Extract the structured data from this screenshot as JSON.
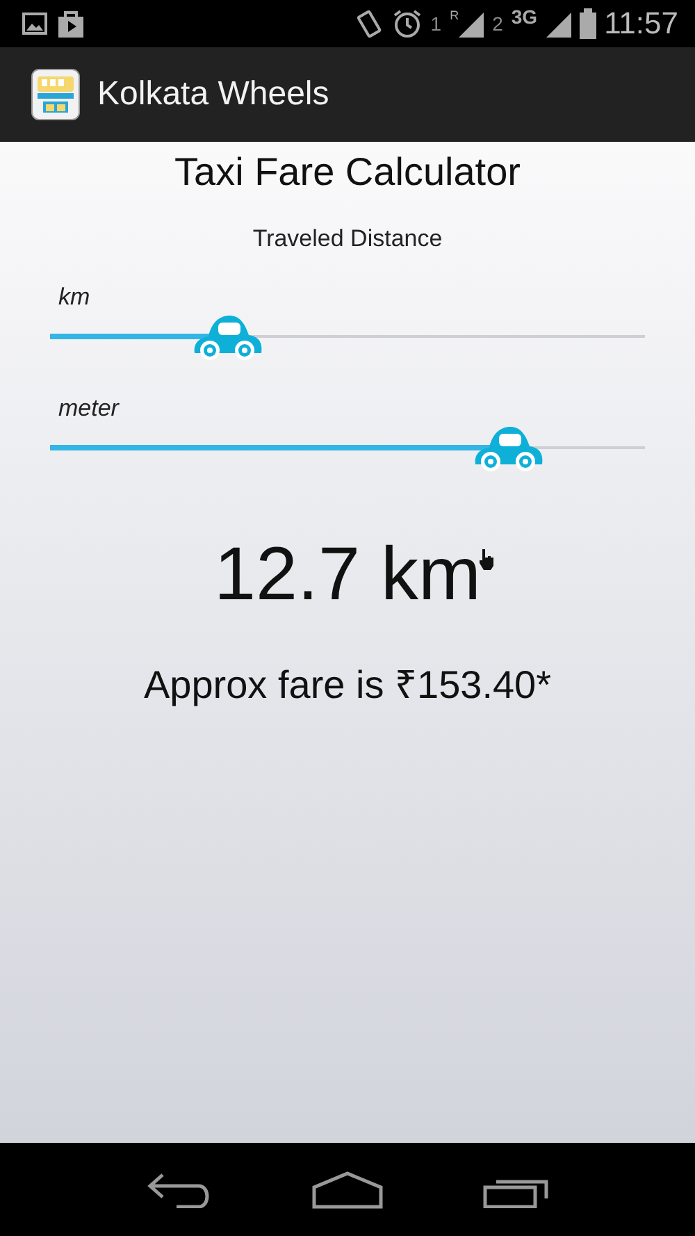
{
  "status_bar": {
    "sim1": "1",
    "roaming": "R",
    "sim2": "2",
    "network": "3G",
    "time": "11:57"
  },
  "app_bar": {
    "title": "Kolkata Wheels"
  },
  "heading": "Taxi Fare Calculator",
  "distance_label": "Traveled Distance",
  "sliders": [
    {
      "label": "km",
      "level": 0.3
    },
    {
      "label": "meter",
      "level": 0.77
    }
  ],
  "distance": "12.7 km",
  "fare": "Approx fare is ₹153.40*"
}
